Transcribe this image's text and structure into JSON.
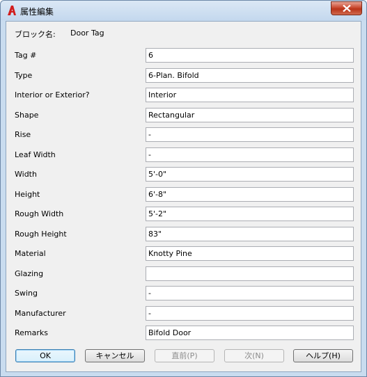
{
  "window": {
    "title": "属性編集",
    "colors": {
      "frame": "#c9dcef",
      "close": "#c9482f",
      "client": "#f0f0f0"
    }
  },
  "block": {
    "label": "ブロック名:",
    "value": "Door Tag"
  },
  "attributes": [
    {
      "label": "Tag #",
      "value": "6"
    },
    {
      "label": "Type",
      "value": "6-Plan. Bifold"
    },
    {
      "label": "Interior or Exterior?",
      "value": "Interior"
    },
    {
      "label": "Shape",
      "value": "Rectangular"
    },
    {
      "label": "Rise",
      "value": "-"
    },
    {
      "label": "Leaf Width",
      "value": "-"
    },
    {
      "label": "Width",
      "value": "5'-0\""
    },
    {
      "label": "Height",
      "value": "6'-8\""
    },
    {
      "label": "Rough Width",
      "value": "5'-2\""
    },
    {
      "label": "Rough Height",
      "value": "83\""
    },
    {
      "label": "Material",
      "value": "Knotty Pine"
    },
    {
      "label": "Glazing",
      "value": ""
    },
    {
      "label": "Swing",
      "value": "-"
    },
    {
      "label": "Manufacturer",
      "value": "-"
    },
    {
      "label": "Remarks",
      "value": "Bifold Door"
    }
  ],
  "buttons": {
    "ok": "OK",
    "cancel": "キャンセル",
    "prev": "直前(P)",
    "next": "次(N)",
    "help": "ヘルプ(H)"
  },
  "icons": {
    "app": "autocad-a-icon",
    "close": "close-icon"
  }
}
